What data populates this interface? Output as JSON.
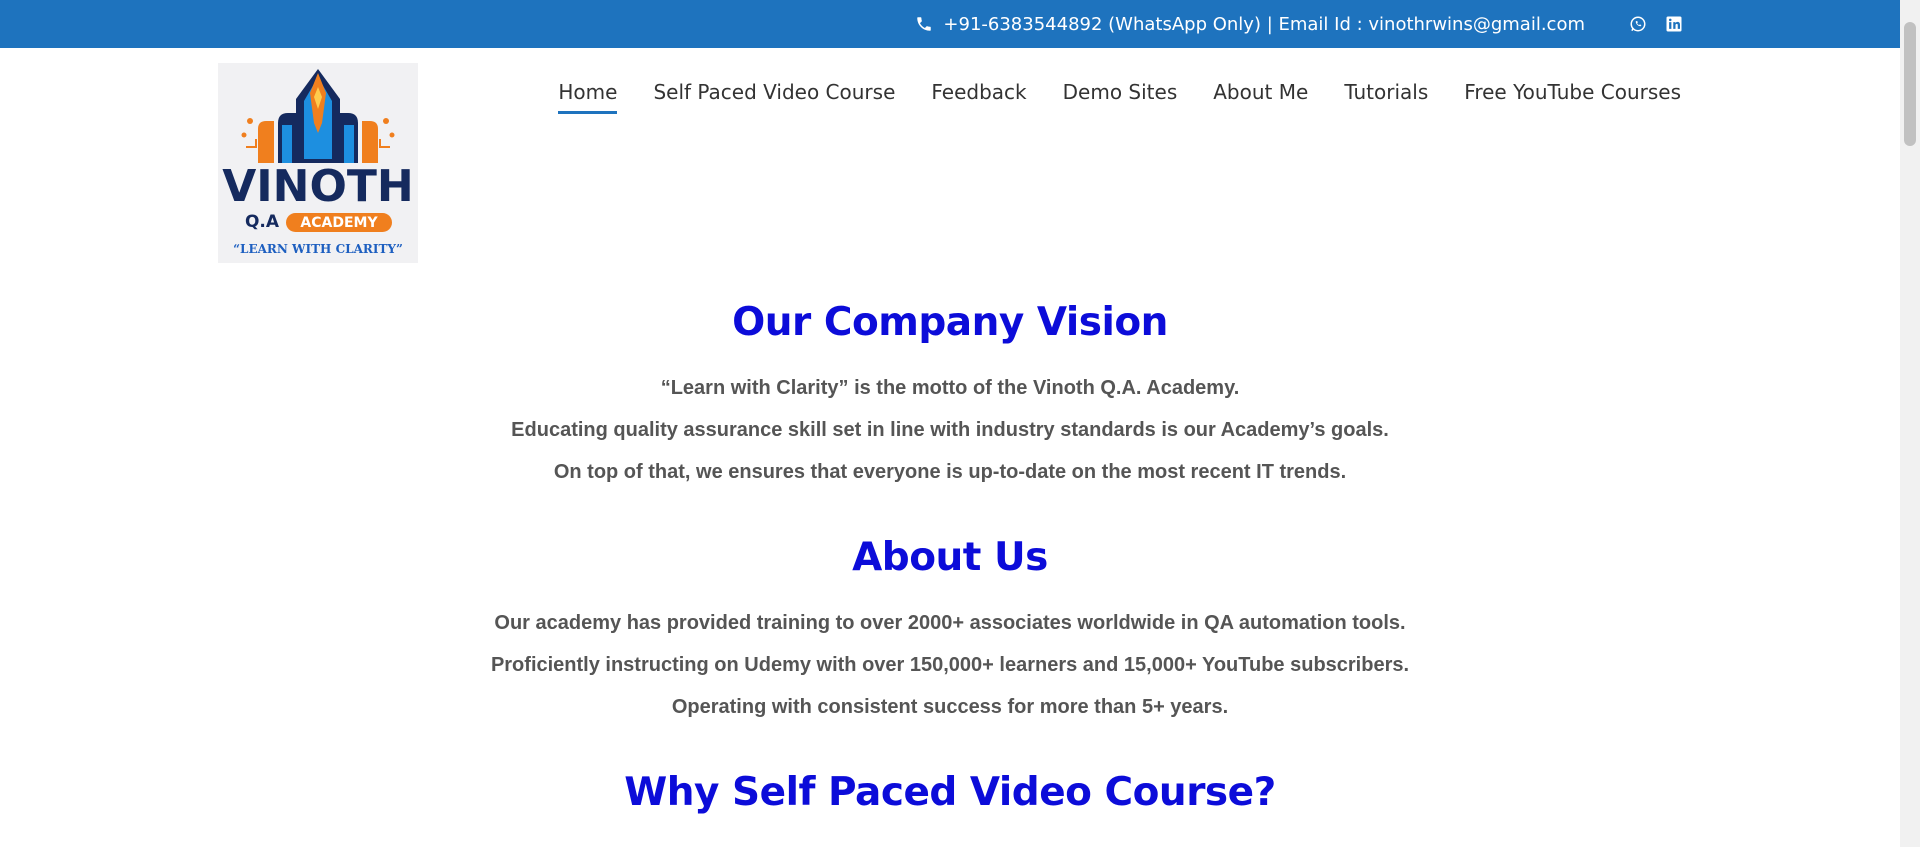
{
  "topbar": {
    "contact_text": "+91-6383544892 (WhatsApp Only) | Email Id : vinothrwins@gmail.com",
    "icons": [
      "phone-icon",
      "whatsapp-icon",
      "linkedin-icon"
    ]
  },
  "logo": {
    "brand": "VINOTH",
    "subtitle_qa": "Q.A",
    "subtitle_academy": "ACADEMY",
    "tagline": "“LEARN WITH CLARITY”"
  },
  "nav": {
    "items": [
      {
        "label": "Home"
      },
      {
        "label": "Self Paced Video Course"
      },
      {
        "label": "Feedback"
      },
      {
        "label": "Demo Sites"
      },
      {
        "label": "About Me"
      },
      {
        "label": "Tutorials"
      },
      {
        "label": "Free YouTube Courses"
      }
    ]
  },
  "sections": {
    "vision": {
      "title": "Our Company Vision",
      "lines": [
        "“Learn with Clarity” is the motto of the Vinoth Q.A. Academy.",
        "Educating quality assurance skill set in line with industry standards is our Academy’s goals.",
        "On top of that, we ensures that everyone is up-to-date on the most recent IT trends."
      ]
    },
    "about": {
      "title": "About Us",
      "lines": [
        "Our academy has provided training to over 2000+ associates worldwide in QA automation tools.",
        "Proficiently instructing on Udemy with over 150,000+ learners and 15,000+ YouTube subscribers.",
        "Operating with consistent success for more than 5+ years."
      ]
    },
    "why": {
      "title": "Why Self Paced Video Course?"
    }
  },
  "colors": {
    "topbar": "#1e73be",
    "heading": "#0c0cd9",
    "body_text": "#555555",
    "nav_text": "#333333",
    "logo_orange": "#f07f1e",
    "logo_navy": "#152a5e",
    "logo_blue": "#1d8fe0"
  }
}
